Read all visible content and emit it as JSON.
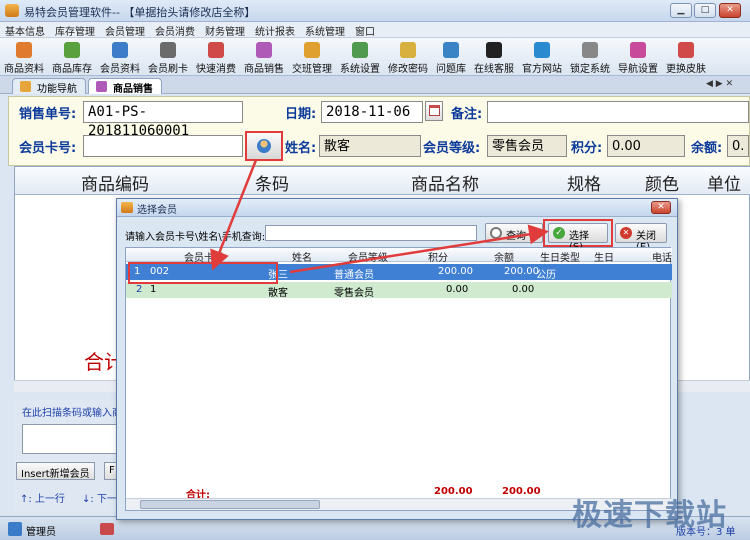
{
  "window": {
    "title": "易特会员管理软件-- 【单据抬头请修改店全称】"
  },
  "menu": [
    "基本信息",
    "库存管理",
    "会员管理",
    "会员消费",
    "财务管理",
    "统计报表",
    "系统管理",
    "窗口"
  ],
  "toolbar": [
    {
      "label": "商品资料",
      "color": "#e07a2e"
    },
    {
      "label": "商品库存",
      "color": "#5aa03c"
    },
    {
      "label": "会员资料",
      "color": "#3c7cc8"
    },
    {
      "label": "会员刷卡",
      "color": "#6b6b6b"
    },
    {
      "label": "快速消费",
      "color": "#d04a4a"
    },
    {
      "label": "商品销售",
      "color": "#b05ab8"
    },
    {
      "label": "交班管理",
      "color": "#e0a030"
    },
    {
      "label": "系统设置",
      "color": "#4f9a4f"
    },
    {
      "label": "修改密码",
      "color": "#d8b040"
    },
    {
      "label": "问题库",
      "color": "#3a84c6"
    },
    {
      "label": "在线客服",
      "color": "#222222"
    },
    {
      "label": "官方网站",
      "color": "#2a8ad0"
    },
    {
      "label": "锁定系统",
      "color": "#888888"
    },
    {
      "label": "导航设置",
      "color": "#c84a9a"
    },
    {
      "label": "更换皮肤",
      "color": "#d04a4a"
    }
  ],
  "tabs": [
    {
      "label": "功能导航"
    },
    {
      "label": "商品销售"
    }
  ],
  "form": {
    "order_label": "销售单号:",
    "order_value": "A01-PS-201811060001",
    "date_label": "日期:",
    "date_value": "2018-11-06",
    "note_label": "备注:",
    "note_value": "",
    "card_label": "会员卡号:",
    "card_value": "",
    "name_label": "姓名:",
    "name_value": "散客",
    "level_label": "会员等级:",
    "level_value": "零售会员",
    "points_label": "积分:",
    "points_value": "0.00",
    "balance_label": "余额:",
    "balance_value": "0."
  },
  "grid": {
    "columns": [
      "商品编码",
      "条码",
      "商品名称",
      "规格",
      "颜色",
      "单位"
    ],
    "total_label": "合计"
  },
  "scan": {
    "label": "在此扫描条码或输入商",
    "insert_btn": "Insert新增会员",
    "f_btn": "F1",
    "prev": "↑: 上一行",
    "next": "↓: 下一"
  },
  "status": {
    "user": "管理员",
    "version": "版本号：3 单"
  },
  "dialog": {
    "title": "选择会员",
    "search_label": "请输入会员卡号\\姓名\\手机查询:",
    "search_value": "",
    "query_btn": "查询",
    "select_btn": "选择(S)",
    "close_btn": "关闭(E)",
    "columns": [
      "会员卡号",
      "姓名",
      "会员等级",
      "积分",
      "余额",
      "生日类型",
      "生日",
      "电话"
    ],
    "rows": [
      {
        "idx": "1",
        "card": "002",
        "name": "张三",
        "level": "普通会员",
        "points": "200.00",
        "balance": "200.00",
        "btype": "公历",
        "bday": ""
      },
      {
        "idx": "2",
        "card": "1",
        "name": "散客",
        "level": "零售会员",
        "points": "0.00",
        "balance": "0.00",
        "btype": "",
        "bday": ""
      }
    ],
    "total_label": "合计:",
    "total_points": "200.00",
    "total_balance": "200.00"
  },
  "watermark": "极速下载站"
}
